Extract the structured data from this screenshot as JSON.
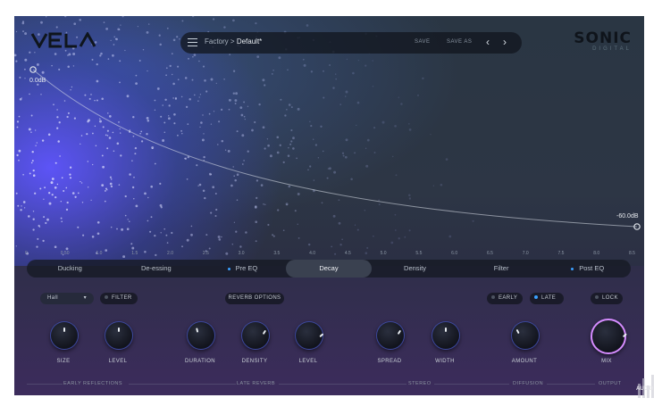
{
  "app": {
    "logo": "VELA",
    "brand_name": "SONIC",
    "brand_sub": "DIGITAL"
  },
  "topbar": {
    "menu_icon": "menu-icon",
    "breadcrumb_parent": "Factory",
    "breadcrumb_sep": ">",
    "preset_name": "Default*",
    "save_label": "SAVE",
    "save_as_label": "SAVE AS",
    "prev_icon": "chevron-left-icon",
    "next_icon": "chevron-right-icon"
  },
  "curve": {
    "start_label": "0.0dB",
    "end_label": "-60.0dB"
  },
  "time_axis": [
    "0",
    "0.50",
    "1.0",
    "1.5",
    "2.0",
    "2.5",
    "3.0",
    "3.5",
    "4.0",
    "4.5",
    "5.0",
    "5.5",
    "6.0",
    "6.5",
    "7.0",
    "7.5",
    "8.0",
    "8.5"
  ],
  "tabs": [
    {
      "label": "Ducking",
      "dot": false,
      "active": false
    },
    {
      "label": "De-essing",
      "dot": false,
      "active": false
    },
    {
      "label": "Pre EQ",
      "dot": true,
      "active": false
    },
    {
      "label": "Decay",
      "dot": false,
      "active": true
    },
    {
      "label": "Density",
      "dot": false,
      "active": false
    },
    {
      "label": "Filter",
      "dot": false,
      "active": false
    },
    {
      "label": "Post EQ",
      "dot": true,
      "active": false
    }
  ],
  "controls": {
    "hall_select": "Hall",
    "filter_label": "FILTER",
    "reverb_options_label": "REVERB OPTIONS",
    "early_label": "EARLY",
    "late_label": "LATE",
    "lock_label": "LOCK"
  },
  "knobs": [
    {
      "label": "SIZE",
      "value": 0.5
    },
    {
      "label": "LEVEL",
      "value": 0.5
    },
    {
      "label": "DURATION",
      "value": 0.45
    },
    {
      "label": "DENSITY",
      "value": 0.62
    },
    {
      "label": "LEVEL",
      "value": 0.68
    },
    {
      "label": "SPREAD",
      "value": 0.62
    },
    {
      "label": "WIDTH",
      "value": 0.5
    },
    {
      "label": "AMOUNT",
      "value": 0.4
    },
    {
      "label": "MIX",
      "value": 0.68
    }
  ],
  "sections": [
    "EARLY REFLECTIONS",
    "LATE REVERB",
    "STEREO",
    "DIFFUSION",
    "OUTPUT"
  ],
  "colors": {
    "accent": "#3aa0ff",
    "particle_glow": "#6a5cff",
    "mix_ring": "#e0a0ff"
  },
  "watermark": "AUDIO"
}
